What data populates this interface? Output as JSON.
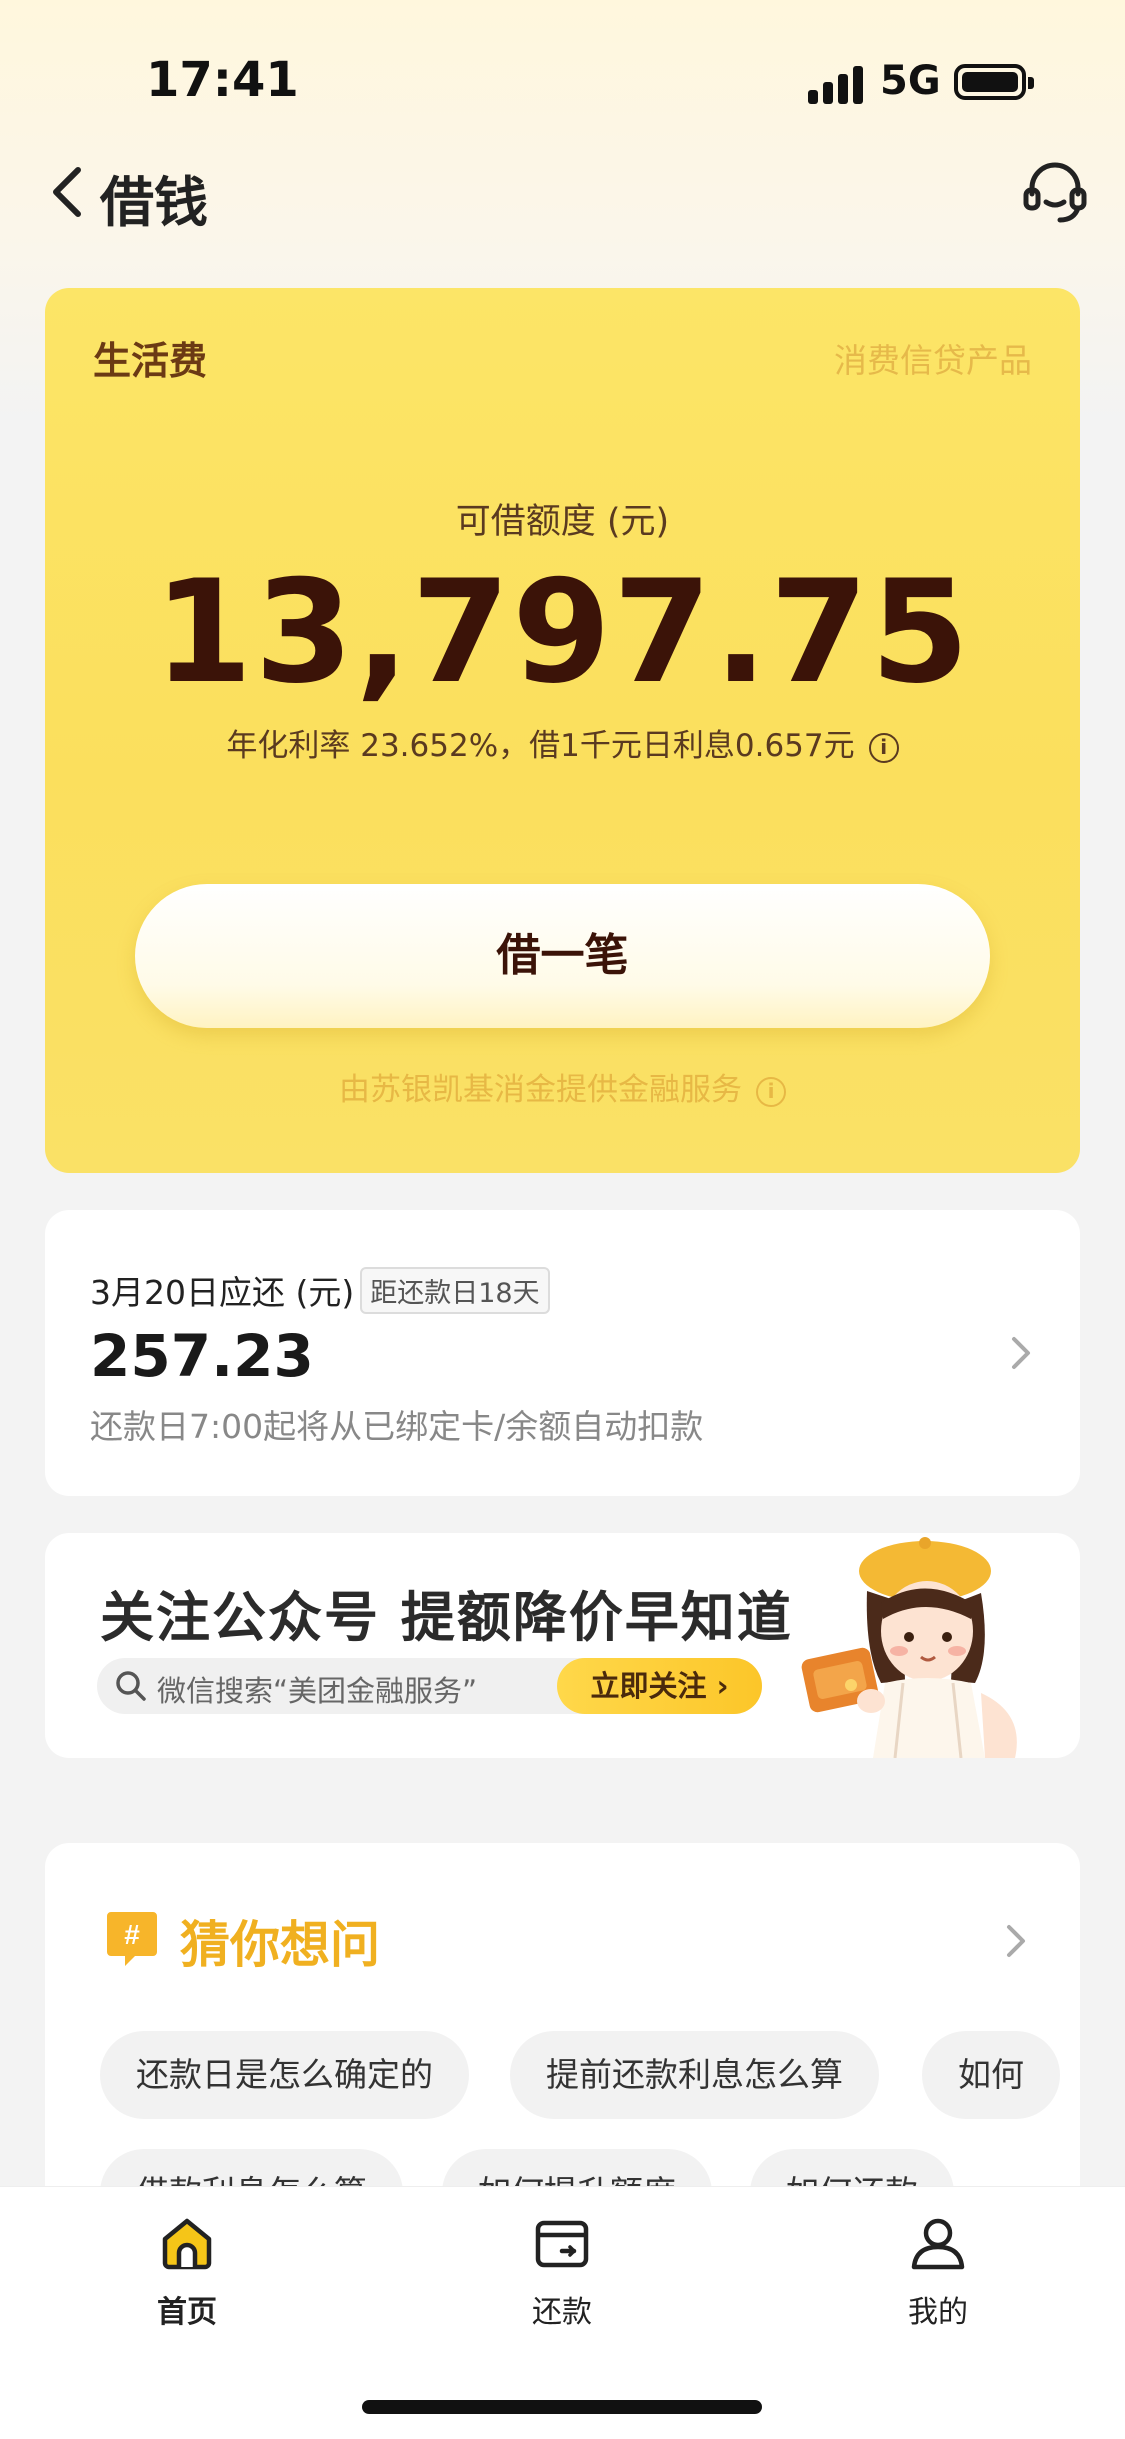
{
  "status_bar": {
    "time": "17:41",
    "network": "5G"
  },
  "nav": {
    "title": "借钱"
  },
  "loan_card": {
    "product_label": "生活费",
    "product_type": "消费信贷产品",
    "limit_caption": "可借额度 (元)",
    "limit_value": "13,797.75",
    "rate_text": "年化利率 23.652%，借1千元日利息0.657元",
    "borrow_button": "借一笔",
    "provider_text": "由苏银凯基消金提供金融服务"
  },
  "repayment": {
    "title": "3月20日应还 (元)",
    "badge": "距还款日18天",
    "amount": "257.23",
    "note": "还款日7:00起将从已绑定卡/余额自动扣款"
  },
  "banner": {
    "title": "关注公众号 提额降价早知道",
    "search_text": "微信搜索“美团金融服务”",
    "follow_button": "立即关注 ›"
  },
  "faq": {
    "title": "猜你想问",
    "chips_row1": [
      "还款日是怎么确定的",
      "提前还款利息怎么算",
      "如何"
    ],
    "chips_row2": [
      "借款利息怎么算",
      "如何提升额度",
      "如何还款"
    ]
  },
  "tabbar": {
    "tabs": [
      {
        "label": "首页",
        "active": true
      },
      {
        "label": "还款",
        "active": false
      },
      {
        "label": "我的",
        "active": false
      }
    ]
  },
  "colors": {
    "card_yellow": "#fbdf5d",
    "brand_dark": "#3b1308",
    "faq_accent": "#f0b020",
    "tab_active": "#f5c518"
  }
}
